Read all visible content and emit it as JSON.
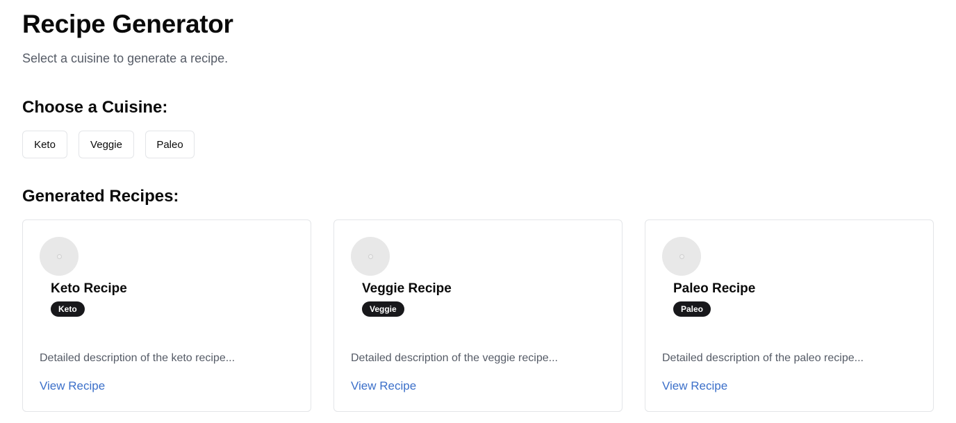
{
  "header": {
    "title": "Recipe Generator",
    "subtitle": "Select a cuisine to generate a recipe."
  },
  "cuisine_section": {
    "heading": "Choose a Cuisine:",
    "buttons": [
      {
        "label": "Keto"
      },
      {
        "label": "Veggie"
      },
      {
        "label": "Paleo"
      }
    ]
  },
  "recipes_section": {
    "heading": "Generated Recipes:",
    "cards": [
      {
        "title": "Keto Recipe",
        "badge": "Keto",
        "description": "Detailed description of the keto recipe...",
        "link_label": "View Recipe",
        "image_icon": "image-placeholder-icon"
      },
      {
        "title": "Veggie Recipe",
        "badge": "Veggie",
        "description": "Detailed description of the veggie recipe...",
        "link_label": "View Recipe",
        "image_icon": "image-placeholder-icon"
      },
      {
        "title": "Paleo Recipe",
        "badge": "Paleo",
        "description": "Detailed description of the paleo recipe...",
        "link_label": "View Recipe",
        "image_icon": "image-placeholder-icon"
      }
    ]
  },
  "colors": {
    "badge_background": "#18181b",
    "link": "#3b6fc9",
    "muted_text": "#555b66",
    "border": "#e3e5e8"
  }
}
